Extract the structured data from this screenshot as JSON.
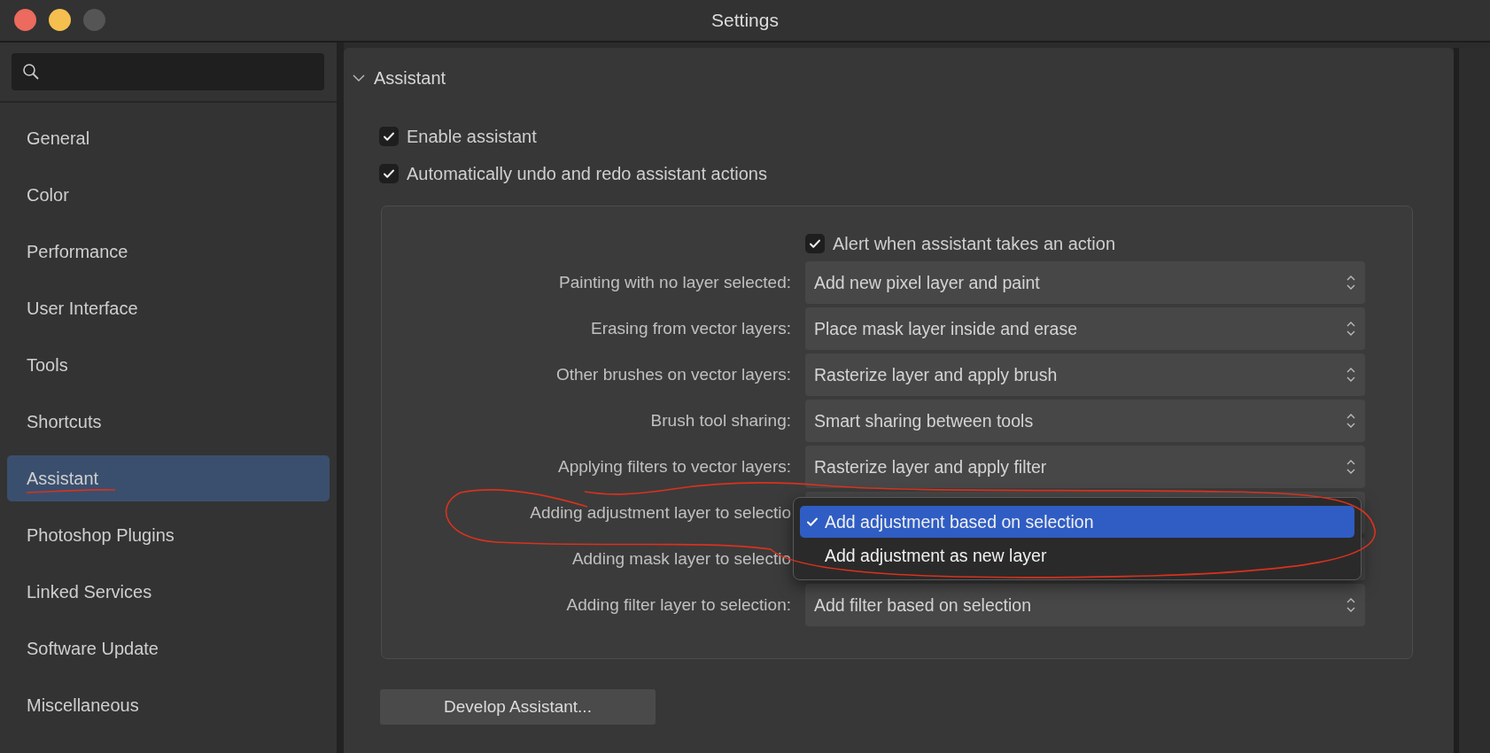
{
  "window": {
    "title": "Settings"
  },
  "sidebar": {
    "items": [
      {
        "label": "General",
        "selected": false
      },
      {
        "label": "Color",
        "selected": false
      },
      {
        "label": "Performance",
        "selected": false
      },
      {
        "label": "User Interface",
        "selected": false
      },
      {
        "label": "Tools",
        "selected": false
      },
      {
        "label": "Shortcuts",
        "selected": false
      },
      {
        "label": "Assistant",
        "selected": true
      },
      {
        "label": "Photoshop Plugins",
        "selected": false
      },
      {
        "label": "Linked Services",
        "selected": false
      },
      {
        "label": "Software Update",
        "selected": false
      },
      {
        "label": "Miscellaneous",
        "selected": false
      }
    ]
  },
  "section": {
    "title": "Assistant",
    "expanded": true,
    "checkboxes": [
      {
        "label": "Enable assistant",
        "checked": true
      },
      {
        "label": "Automatically undo and redo assistant actions",
        "checked": true
      }
    ],
    "group": {
      "alert": {
        "label": "Alert when assistant takes an action",
        "checked": true
      },
      "rows": [
        {
          "label": "Painting with no layer selected:",
          "value": "Add new pixel layer and paint"
        },
        {
          "label": "Erasing from vector layers:",
          "value": "Place mask layer inside and erase"
        },
        {
          "label": "Other brushes on vector layers:",
          "value": "Rasterize layer and apply brush"
        },
        {
          "label": "Brush tool sharing:",
          "value": "Smart sharing between tools"
        },
        {
          "label": "Applying filters to vector layers:",
          "value": "Rasterize layer and apply filter"
        },
        {
          "label": "Adding adjustment layer to selectio"
        },
        {
          "label": "Adding mask layer to selectio"
        },
        {
          "label": "Adding filter layer to selection:",
          "value": "Add filter based on selection"
        }
      ],
      "popup": {
        "options": [
          {
            "label": "Add adjustment based on selection",
            "selected": true
          },
          {
            "label": "Add adjustment as new layer",
            "selected": false
          }
        ]
      }
    },
    "button": "Develop Assistant..."
  }
}
